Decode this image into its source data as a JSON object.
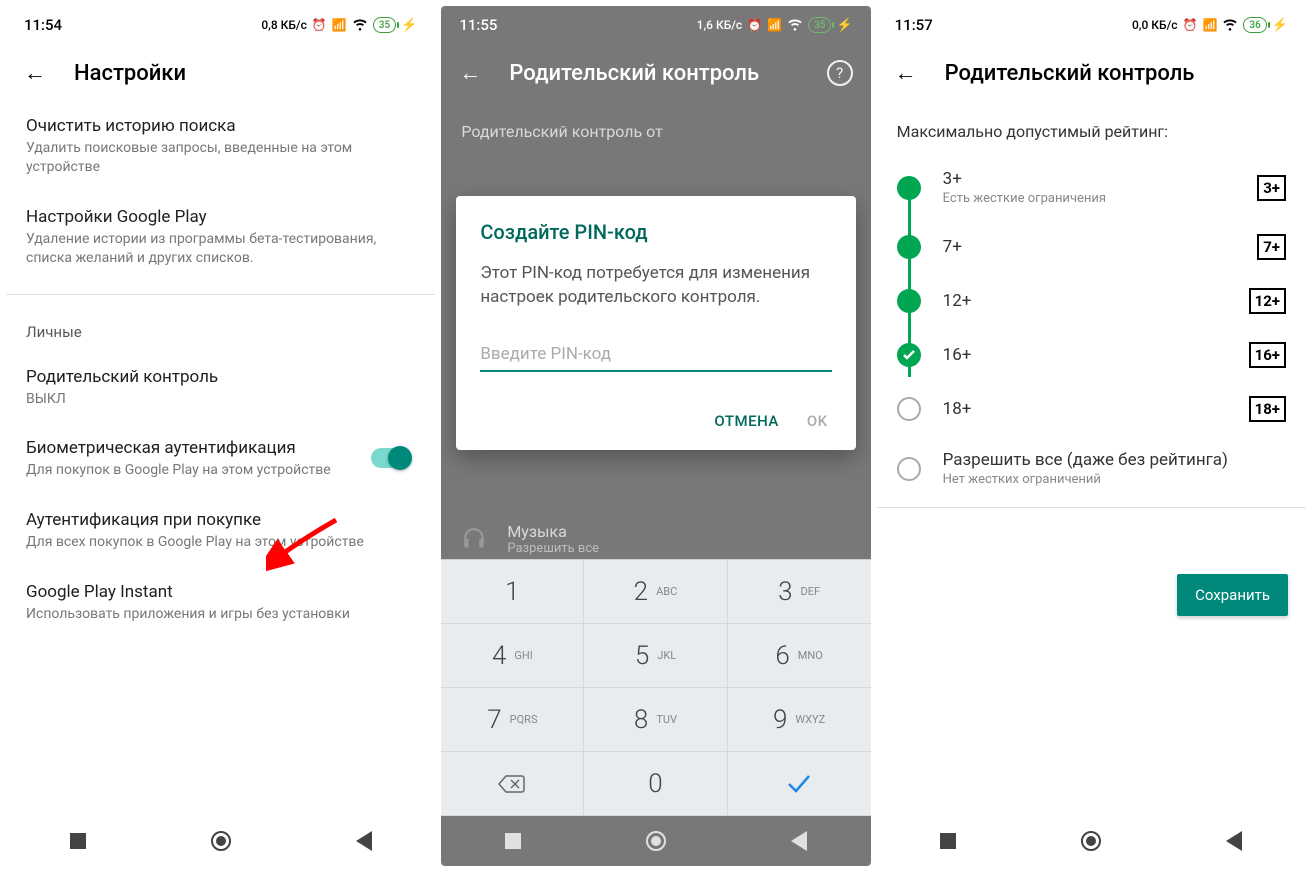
{
  "screen1": {
    "time": "11:54",
    "net": "0,8 КБ/с",
    "batt": "35",
    "title": "Настройки",
    "items": [
      {
        "t": "Очистить историю поиска",
        "s": "Удалить поисковые запросы, введенные на этом устройстве"
      },
      {
        "t": "Настройки Google Play",
        "s": "Удаление истории из программы бета-тестирования, списка желаний и других списков."
      }
    ],
    "section": "Личные",
    "items2": [
      {
        "t": "Родительский контроль",
        "s": "ВЫКЛ"
      },
      {
        "t": "Биометрическая аутентификация",
        "s": "Для покупок в Google Play на этом устройстве",
        "toggle": true
      },
      {
        "t": "Аутентификация при покупке",
        "s": "Для всех покупок в Google Play на этом устройстве"
      },
      {
        "t": "Google Play Instant",
        "s": "Использовать приложения и игры без установки"
      }
    ]
  },
  "screen2": {
    "time": "11:55",
    "net": "1,6 КБ/с",
    "batt": "35",
    "title": "Родительский контроль",
    "bg_partial": "Родительский контроль от",
    "music": {
      "t": "Музыка",
      "s": "Разрешить все"
    },
    "dialog": {
      "title": "Создайте PIN-код",
      "text": "Этот PIN-код потребуется для изменения настроек родительского контроля.",
      "placeholder": "Введите PIN-код",
      "cancel": "ОТМЕНА",
      "ok": "OK"
    },
    "keys": [
      [
        "1",
        ""
      ],
      [
        "2",
        "ABC"
      ],
      [
        "3",
        "DEF"
      ],
      [
        "4",
        "GHI"
      ],
      [
        "5",
        "JKL"
      ],
      [
        "6",
        "MNO"
      ],
      [
        "7",
        "PQRS"
      ],
      [
        "8",
        "TUV"
      ],
      [
        "9",
        "WXYZ"
      ],
      [
        "del",
        ""
      ],
      [
        "0",
        ""
      ],
      [
        "ok",
        ""
      ]
    ]
  },
  "screen3": {
    "time": "11:57",
    "net": "0,0 КБ/с",
    "batt": "36",
    "title": "Родительский контроль",
    "heading": "Максимально допустимый рейтинг:",
    "ratings": [
      {
        "label": "3+",
        "sub": "Есть жесткие ограничения",
        "badge": "3+",
        "state": "on"
      },
      {
        "label": "7+",
        "badge": "7+",
        "state": "on"
      },
      {
        "label": "12+",
        "badge": "12+",
        "state": "on"
      },
      {
        "label": "16+",
        "badge": "16+",
        "state": "sel"
      },
      {
        "label": "18+",
        "badge": "18+",
        "state": "off"
      },
      {
        "label": "Разрешить все (даже без рейтинга)",
        "sub": "Нет жестких ограничений",
        "state": "off"
      }
    ],
    "save": "Сохранить"
  }
}
